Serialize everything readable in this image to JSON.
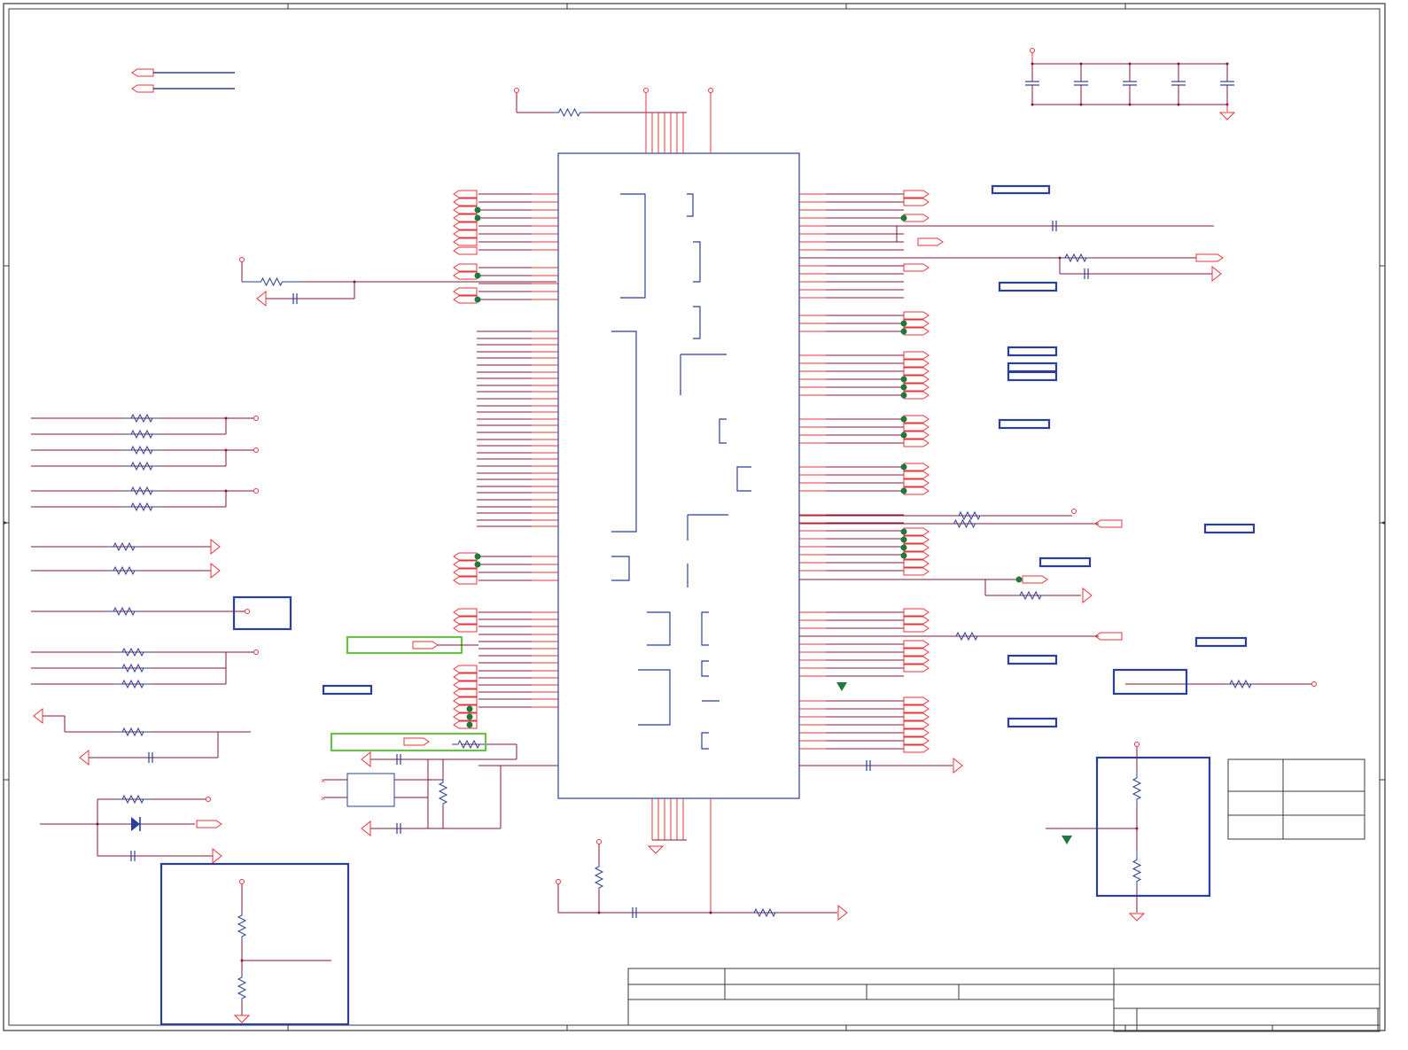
{
  "colors": {
    "wire": "#e8333a",
    "net": "#8a1538",
    "component": "#2b3f9a",
    "border": "#3a3a3a",
    "highlight": "#6cc04a",
    "junction": "#1e7a3c"
  },
  "sheet": {
    "title": "",
    "border_zones": []
  },
  "main_ic": {
    "designator": "",
    "part": ""
  },
  "power_flags": [],
  "net_labels": [],
  "title_block": {
    "company": "",
    "title": "",
    "size": "",
    "document_number": "",
    "revision": "",
    "date": "",
    "sheet": ""
  },
  "notes": []
}
